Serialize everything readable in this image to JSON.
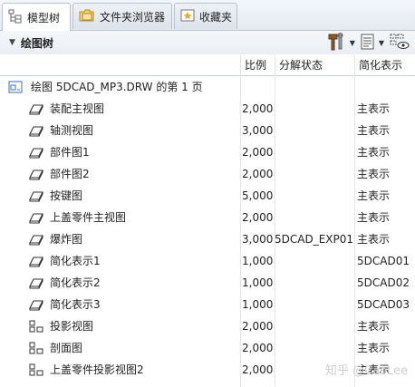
{
  "tabs": [
    {
      "label": "模型树"
    },
    {
      "label": "文件夹浏览器"
    },
    {
      "label": "收藏夹"
    }
  ],
  "tree_header": {
    "title": "绘图树"
  },
  "columns": {
    "scale": "比例",
    "exploded_state": "分解状态",
    "simplified_rep": "简化表示"
  },
  "root": {
    "label": "绘图 5DCAD_MP3.DRW 的第 1 页"
  },
  "rows": [
    {
      "name": "装配主视图",
      "scale": "2,000",
      "exploded": "",
      "simplified": "主表示",
      "icon": "view-icon"
    },
    {
      "name": "轴测视图",
      "scale": "3,000",
      "exploded": "",
      "simplified": "主表示",
      "icon": "view-icon"
    },
    {
      "name": "部件图1",
      "scale": "2,000",
      "exploded": "",
      "simplified": "主表示",
      "icon": "view-icon"
    },
    {
      "name": "部件图2",
      "scale": "2,000",
      "exploded": "",
      "simplified": "主表示",
      "icon": "view-icon"
    },
    {
      "name": "按键图",
      "scale": "5,000",
      "exploded": "",
      "simplified": "主表示",
      "icon": "view-icon"
    },
    {
      "name": "上盖零件主视图",
      "scale": "2,000",
      "exploded": "",
      "simplified": "主表示",
      "icon": "view-icon"
    },
    {
      "name": "爆炸图",
      "scale": "3,000",
      "exploded": "5DCAD_EXP01",
      "simplified": "主表示",
      "icon": "view-icon"
    },
    {
      "name": "简化表示1",
      "scale": "1,000",
      "exploded": "",
      "simplified": "5DCAD01",
      "icon": "view-icon"
    },
    {
      "name": "简化表示2",
      "scale": "1,000",
      "exploded": "",
      "simplified": "5DCAD02",
      "icon": "view-icon"
    },
    {
      "name": "简化表示3",
      "scale": "1,000",
      "exploded": "",
      "simplified": "5DCAD03",
      "icon": "view-icon"
    },
    {
      "name": "投影视图",
      "scale": "2,000",
      "exploded": "",
      "simplified": "主表示",
      "icon": "projection-view-icon"
    },
    {
      "name": "剖面图",
      "scale": "2,000",
      "exploded": "",
      "simplified": "主表示",
      "icon": "projection-view-icon"
    },
    {
      "name": "上盖零件投影视图2",
      "scale": "2,000",
      "exploded": "",
      "simplified": "主表示",
      "icon": "projection-view-icon"
    }
  ],
  "watermark": "知乎 @CaoLee",
  "colors": {
    "tab_border": "#b9c3cf",
    "header_bg": "#eaeef3",
    "icon_blue": "#3b6fb6"
  }
}
